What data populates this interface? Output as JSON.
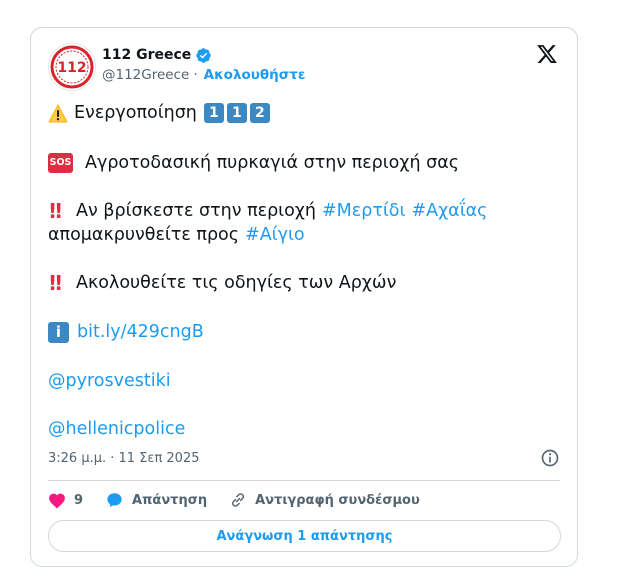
{
  "author": {
    "name": "112 Greece",
    "handle": "@112Greece",
    "separator": "·",
    "follow_label": "Ακολουθήστε",
    "avatar_text": "112"
  },
  "tweet": {
    "line1_text": "Ενεργοποίηση",
    "line1_keys": [
      "1",
      "1",
      "2"
    ],
    "line2_badge": "SOS",
    "line2_text": "Αγροτοδασική πυρκαγιά στην περιοχή σας",
    "line3_prefix": "Αν βρίσκεστε στην περιοχή",
    "line3_hashtag1": "#Μερτίδι",
    "line3_hashtag2": "#Αχαΐας",
    "line4_text": "απομακρυνθείτε προς",
    "line4_hashtag": "#Αίγιο",
    "line5_text": "Ακολουθείτε τις οδηγίες των Αρχών",
    "info_glyph": "i",
    "link": "bit.ly/429cngB",
    "mention1": "@pyrosvestiki",
    "mention2": "@hellenicpolice"
  },
  "timestamp": "3:26 μ.μ. · 11 Σεπ 2025",
  "actions": {
    "like_count": "9",
    "reply_label": "Απάντηση",
    "copy_link_label": "Αντιγραφή συνδέσμου"
  },
  "read_replies_label": "Ανάγνωση 1 απάντησης",
  "colors": {
    "accent": "#1d9bf0",
    "heart": "#f91880",
    "text": "#0f1419",
    "muted": "#536471",
    "border": "#cfd9de"
  }
}
